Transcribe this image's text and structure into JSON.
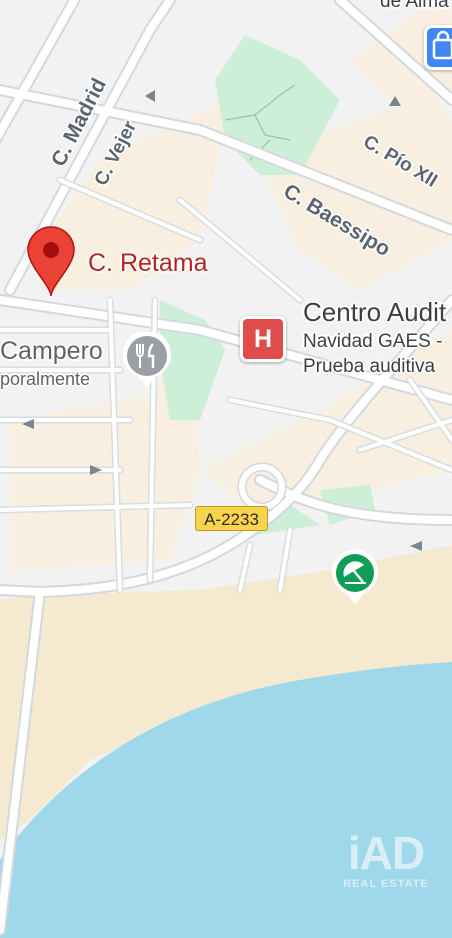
{
  "map": {
    "selected_pin": {
      "label": "C. Retama",
      "color": "#ea4335",
      "icon": "location-pin-icon"
    },
    "streets": {
      "madrid": "C. Madrid",
      "vejer": "C. Vejer",
      "pio_xii": "C. Pío XII",
      "baessipo": "C. Baessipo"
    },
    "road_shield": "A-2233",
    "poi_hospital": {
      "title": "Centro Audit",
      "line1": "Navidad GAES -",
      "line2": "Prueba auditiva",
      "icon": "hospital-icon",
      "icon_letter": "H",
      "color": "#e04b4b"
    },
    "poi_restaurant": {
      "title": "Campero",
      "subtitle": "poralmente",
      "icon": "restaurant-icon"
    },
    "poi_beach": {
      "icon": "beach-umbrella-icon",
      "color": "#0f9d58"
    },
    "poi_shopping": {
      "icon": "shopping-bag-icon",
      "color": "#4285f4"
    },
    "top_cut_label": "de Alma",
    "watermark": {
      "logo": "iAD",
      "subtitle": "REAL ESTATE"
    },
    "colors": {
      "land": "#f2f2f2",
      "block": "#f8efe0",
      "beach": "#f5ead0",
      "water": "#9fd8ea",
      "park": "#cdefd7",
      "road": "#ffffff",
      "road_edge": "#d3d8de"
    }
  }
}
